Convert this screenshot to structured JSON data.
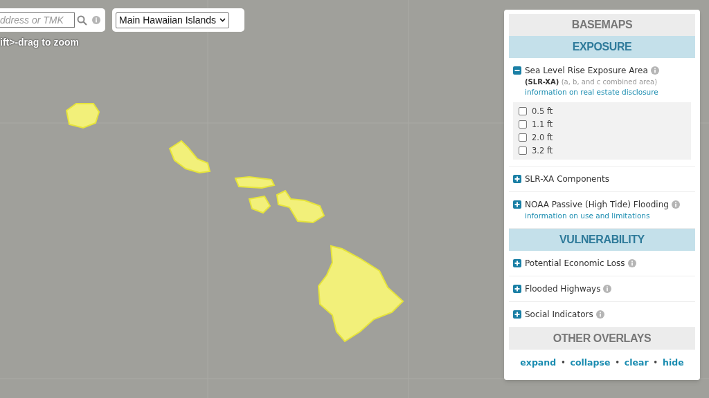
{
  "search": {
    "placeholder": "ddress or TMK"
  },
  "region_select": {
    "value": "Main Hawaiian Islands"
  },
  "hint": "ift>-drag to zoom",
  "panel": {
    "sections": [
      {
        "title": "BASEMAPS",
        "kind": "plain"
      },
      {
        "title": "EXPOSURE",
        "kind": "highlighted",
        "layers": [
          {
            "name": "Sea Level Rise Exposure Area",
            "expanded": true,
            "info": true,
            "subtitle": "(SLR-XA)",
            "note": "(a, b, and c combined area)",
            "link": "information on real estate disclosure",
            "options": [
              {
                "label": "0.5 ft",
                "checked": false
              },
              {
                "label": "1.1 ft",
                "checked": false
              },
              {
                "label": "2.0 ft",
                "checked": false
              },
              {
                "label": "3.2 ft",
                "checked": false
              }
            ]
          },
          {
            "name": "SLR-XA Components",
            "expanded": false,
            "info": false
          },
          {
            "name": "NOAA Passive (High Tide) Flooding",
            "expanded": false,
            "info": true,
            "link": "information on use and limitations"
          }
        ]
      },
      {
        "title": "VULNERABILITY",
        "kind": "highlighted",
        "layers": [
          {
            "name": "Potential Economic Loss",
            "expanded": false,
            "info": true
          },
          {
            "name": "Flooded Highways",
            "expanded": false,
            "info": true
          },
          {
            "name": "Social Indicators",
            "expanded": false,
            "info": true
          }
        ]
      },
      {
        "title": "OTHER OVERLAYS",
        "kind": "plain"
      }
    ],
    "footer": {
      "links": [
        "expand",
        "collapse",
        "clear",
        "hide"
      ],
      "separator": "•"
    }
  }
}
